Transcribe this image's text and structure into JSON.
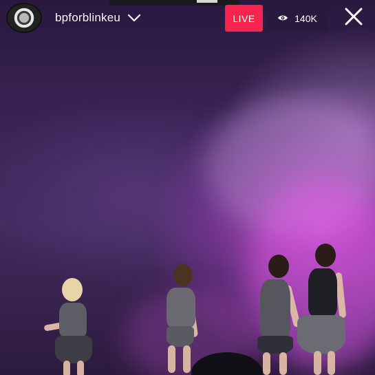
{
  "header": {
    "username": "bpforblinkeu",
    "avatar_icon": "profile-avatar",
    "dropdown_icon": "chevron-down-icon"
  },
  "badges": {
    "live_label": "LIVE",
    "live_color": "#f7254e",
    "viewer_count": "140K",
    "viewer_icon": "eye-icon"
  },
  "controls": {
    "close_icon": "close-icon"
  },
  "video": {
    "scene": "concert-stage",
    "accent_color": "#d650dc"
  }
}
